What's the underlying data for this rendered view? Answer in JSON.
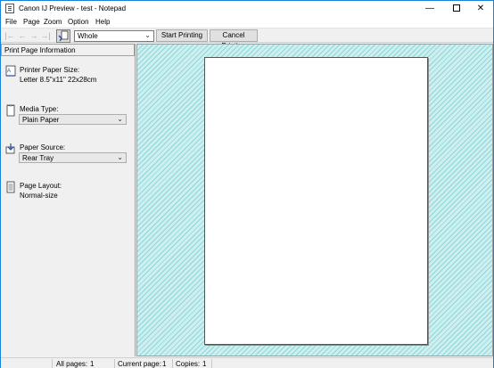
{
  "window": {
    "title": "Canon IJ Preview - test - Notepad",
    "accent_color": "#1883d7",
    "controls": {
      "minimize": "—",
      "close": "✕"
    }
  },
  "menu": [
    "File",
    "Page",
    "Zoom",
    "Option",
    "Help"
  ],
  "toolbar": {
    "nav_icons": [
      "first-page-icon",
      "previous-page-icon",
      "next-page-icon",
      "last-page-icon"
    ],
    "tool_icon": "page-select-tool-icon",
    "zoom_value": "Whole",
    "start_label": "Start Printing",
    "cancel_label": "Cancel Printing"
  },
  "panel": {
    "title": "Print Page Information",
    "paper_size": {
      "label": "Printer Paper Size:",
      "value": "Letter 8.5\"x11\" 22x28cm"
    },
    "media_type": {
      "label": "Media Type:",
      "value": "Plain Paper"
    },
    "paper_source": {
      "label": "Paper Source:",
      "value": "Rear Tray"
    },
    "page_layout": {
      "label": "Page Layout:",
      "value": "Normal-size"
    }
  },
  "status": {
    "all_pages_label": "All pages:",
    "all_pages": "1",
    "current_page_label": "Current page:",
    "current_page": "1",
    "copies_label": "Copies:",
    "copies": "1"
  },
  "colors": {
    "preview_bg": "#cdeff0",
    "preview_hatch": "#8fd6d9"
  }
}
